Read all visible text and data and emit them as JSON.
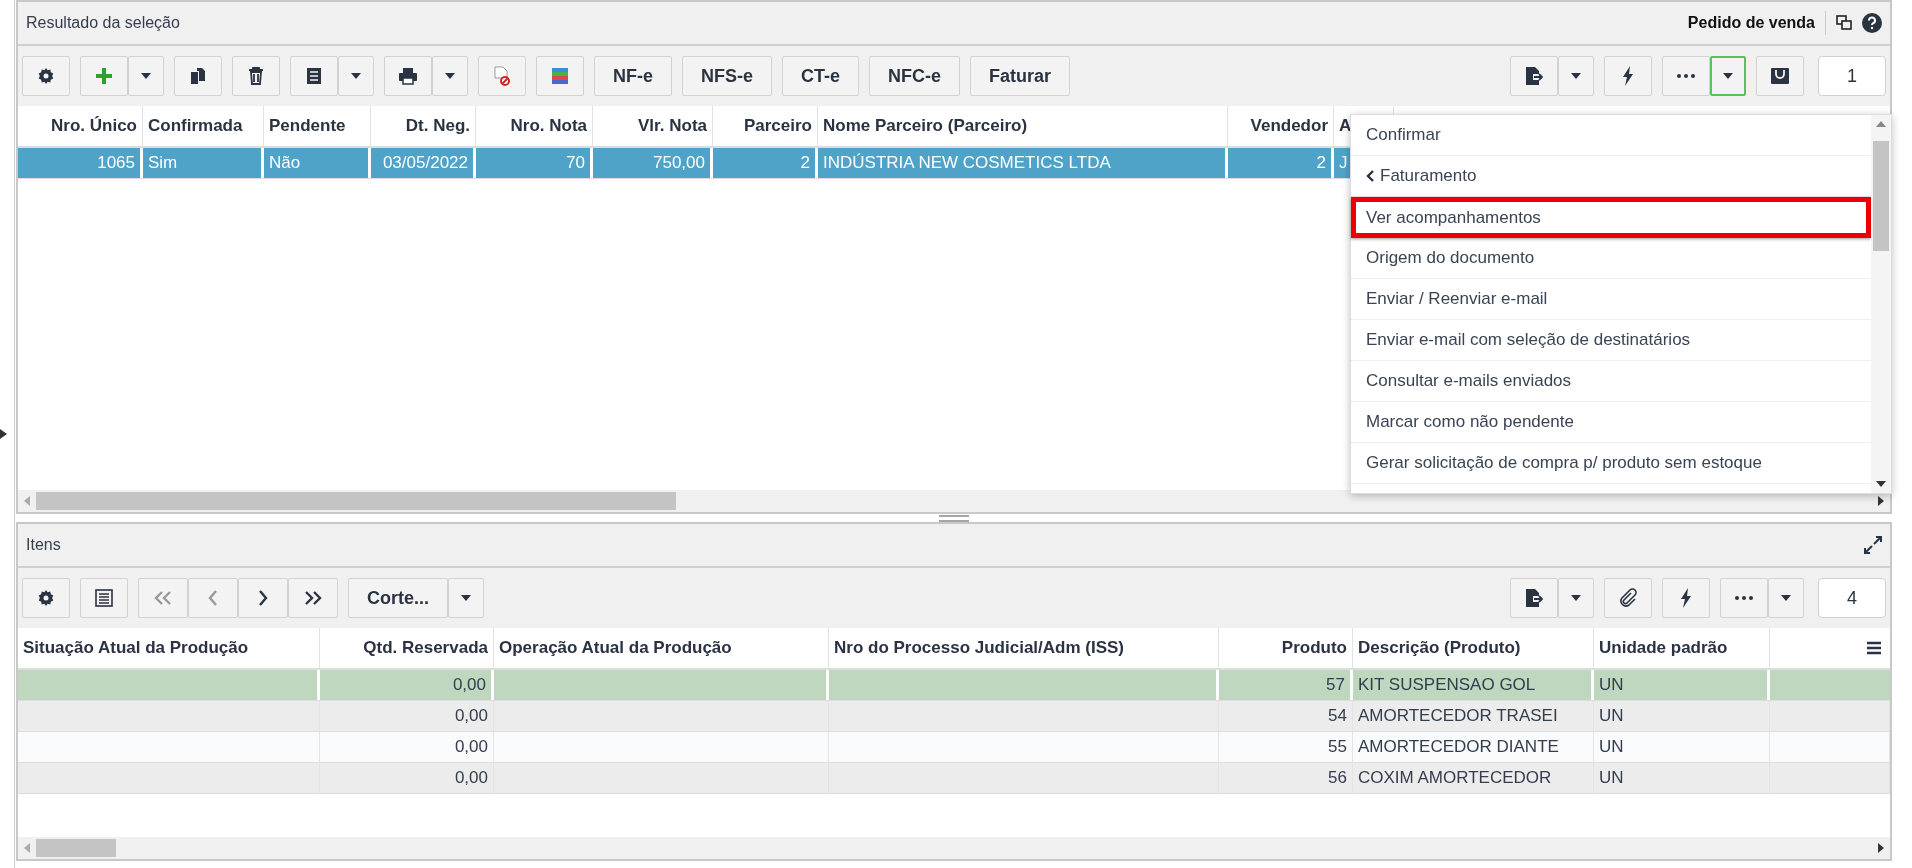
{
  "top_panel": {
    "title": "Resultado da seleção",
    "context": "Pedido de venda",
    "text_buttons": [
      "NF-e",
      "NFS-e",
      "CT-e",
      "NFC-e",
      "Faturar"
    ],
    "counter": "1",
    "columns": [
      "Nro. Único",
      "Confirmada",
      "Pendente",
      "Dt. Neg.",
      "Nro. Nota",
      "Vlr. Nota",
      "Parceiro",
      "Nome Parceiro (Parceiro)",
      "Vendedor",
      "A"
    ],
    "rows": [
      {
        "selected": true,
        "cells": [
          "1065",
          "Sim",
          "Não",
          "03/05/2022",
          "70",
          "750,00",
          "2",
          "INDÚSTRIA NEW COSMETICS LTDA",
          "2",
          "J"
        ]
      }
    ]
  },
  "menu": {
    "open": true,
    "items": [
      {
        "label": "Confirmar",
        "kind": "action",
        "highlighted": false
      },
      {
        "label": "Faturamento",
        "kind": "submenu",
        "highlighted": false
      },
      {
        "label": "Ver acompanhamentos",
        "kind": "action",
        "highlighted": true
      },
      {
        "label": "Origem do documento",
        "kind": "action",
        "highlighted": false
      },
      {
        "label": "Enviar / Reenviar e-mail",
        "kind": "action",
        "highlighted": false
      },
      {
        "label": "Enviar e-mail com seleção de destinatários",
        "kind": "action",
        "highlighted": false
      },
      {
        "label": "Consultar e-mails enviados",
        "kind": "action",
        "highlighted": false
      },
      {
        "label": "Marcar como não pendente",
        "kind": "action",
        "highlighted": false
      },
      {
        "label": "Gerar solicitação de compra p/ produto sem estoque",
        "kind": "action",
        "highlighted": false
      }
    ]
  },
  "bottom_panel": {
    "title": "Itens",
    "filter_button": "Corte...",
    "counter": "4",
    "columns": [
      "Situação Atual da Produção",
      "Qtd. Reservada",
      "Operação Atual da Produção",
      "Nro do Processo Judicial/Adm (ISS)",
      "Produto",
      "Descrição (Produto)",
      "Unidade padrão"
    ],
    "rows": [
      {
        "selected": true,
        "cells": [
          null,
          "0,00",
          null,
          null,
          "57",
          "KIT SUSPENSAO GOL",
          "UN"
        ]
      },
      {
        "selected": false,
        "cells": [
          null,
          "0,00",
          null,
          null,
          "54",
          "AMORTECEDOR TRASEI",
          "UN"
        ]
      },
      {
        "selected": false,
        "cells": [
          null,
          "0,00",
          null,
          null,
          "55",
          "AMORTECEDOR DIANTE",
          "UN"
        ]
      },
      {
        "selected": false,
        "cells": [
          null,
          "0,00",
          null,
          null,
          "56",
          "COXIM AMORTECEDOR",
          "UN"
        ]
      }
    ]
  }
}
